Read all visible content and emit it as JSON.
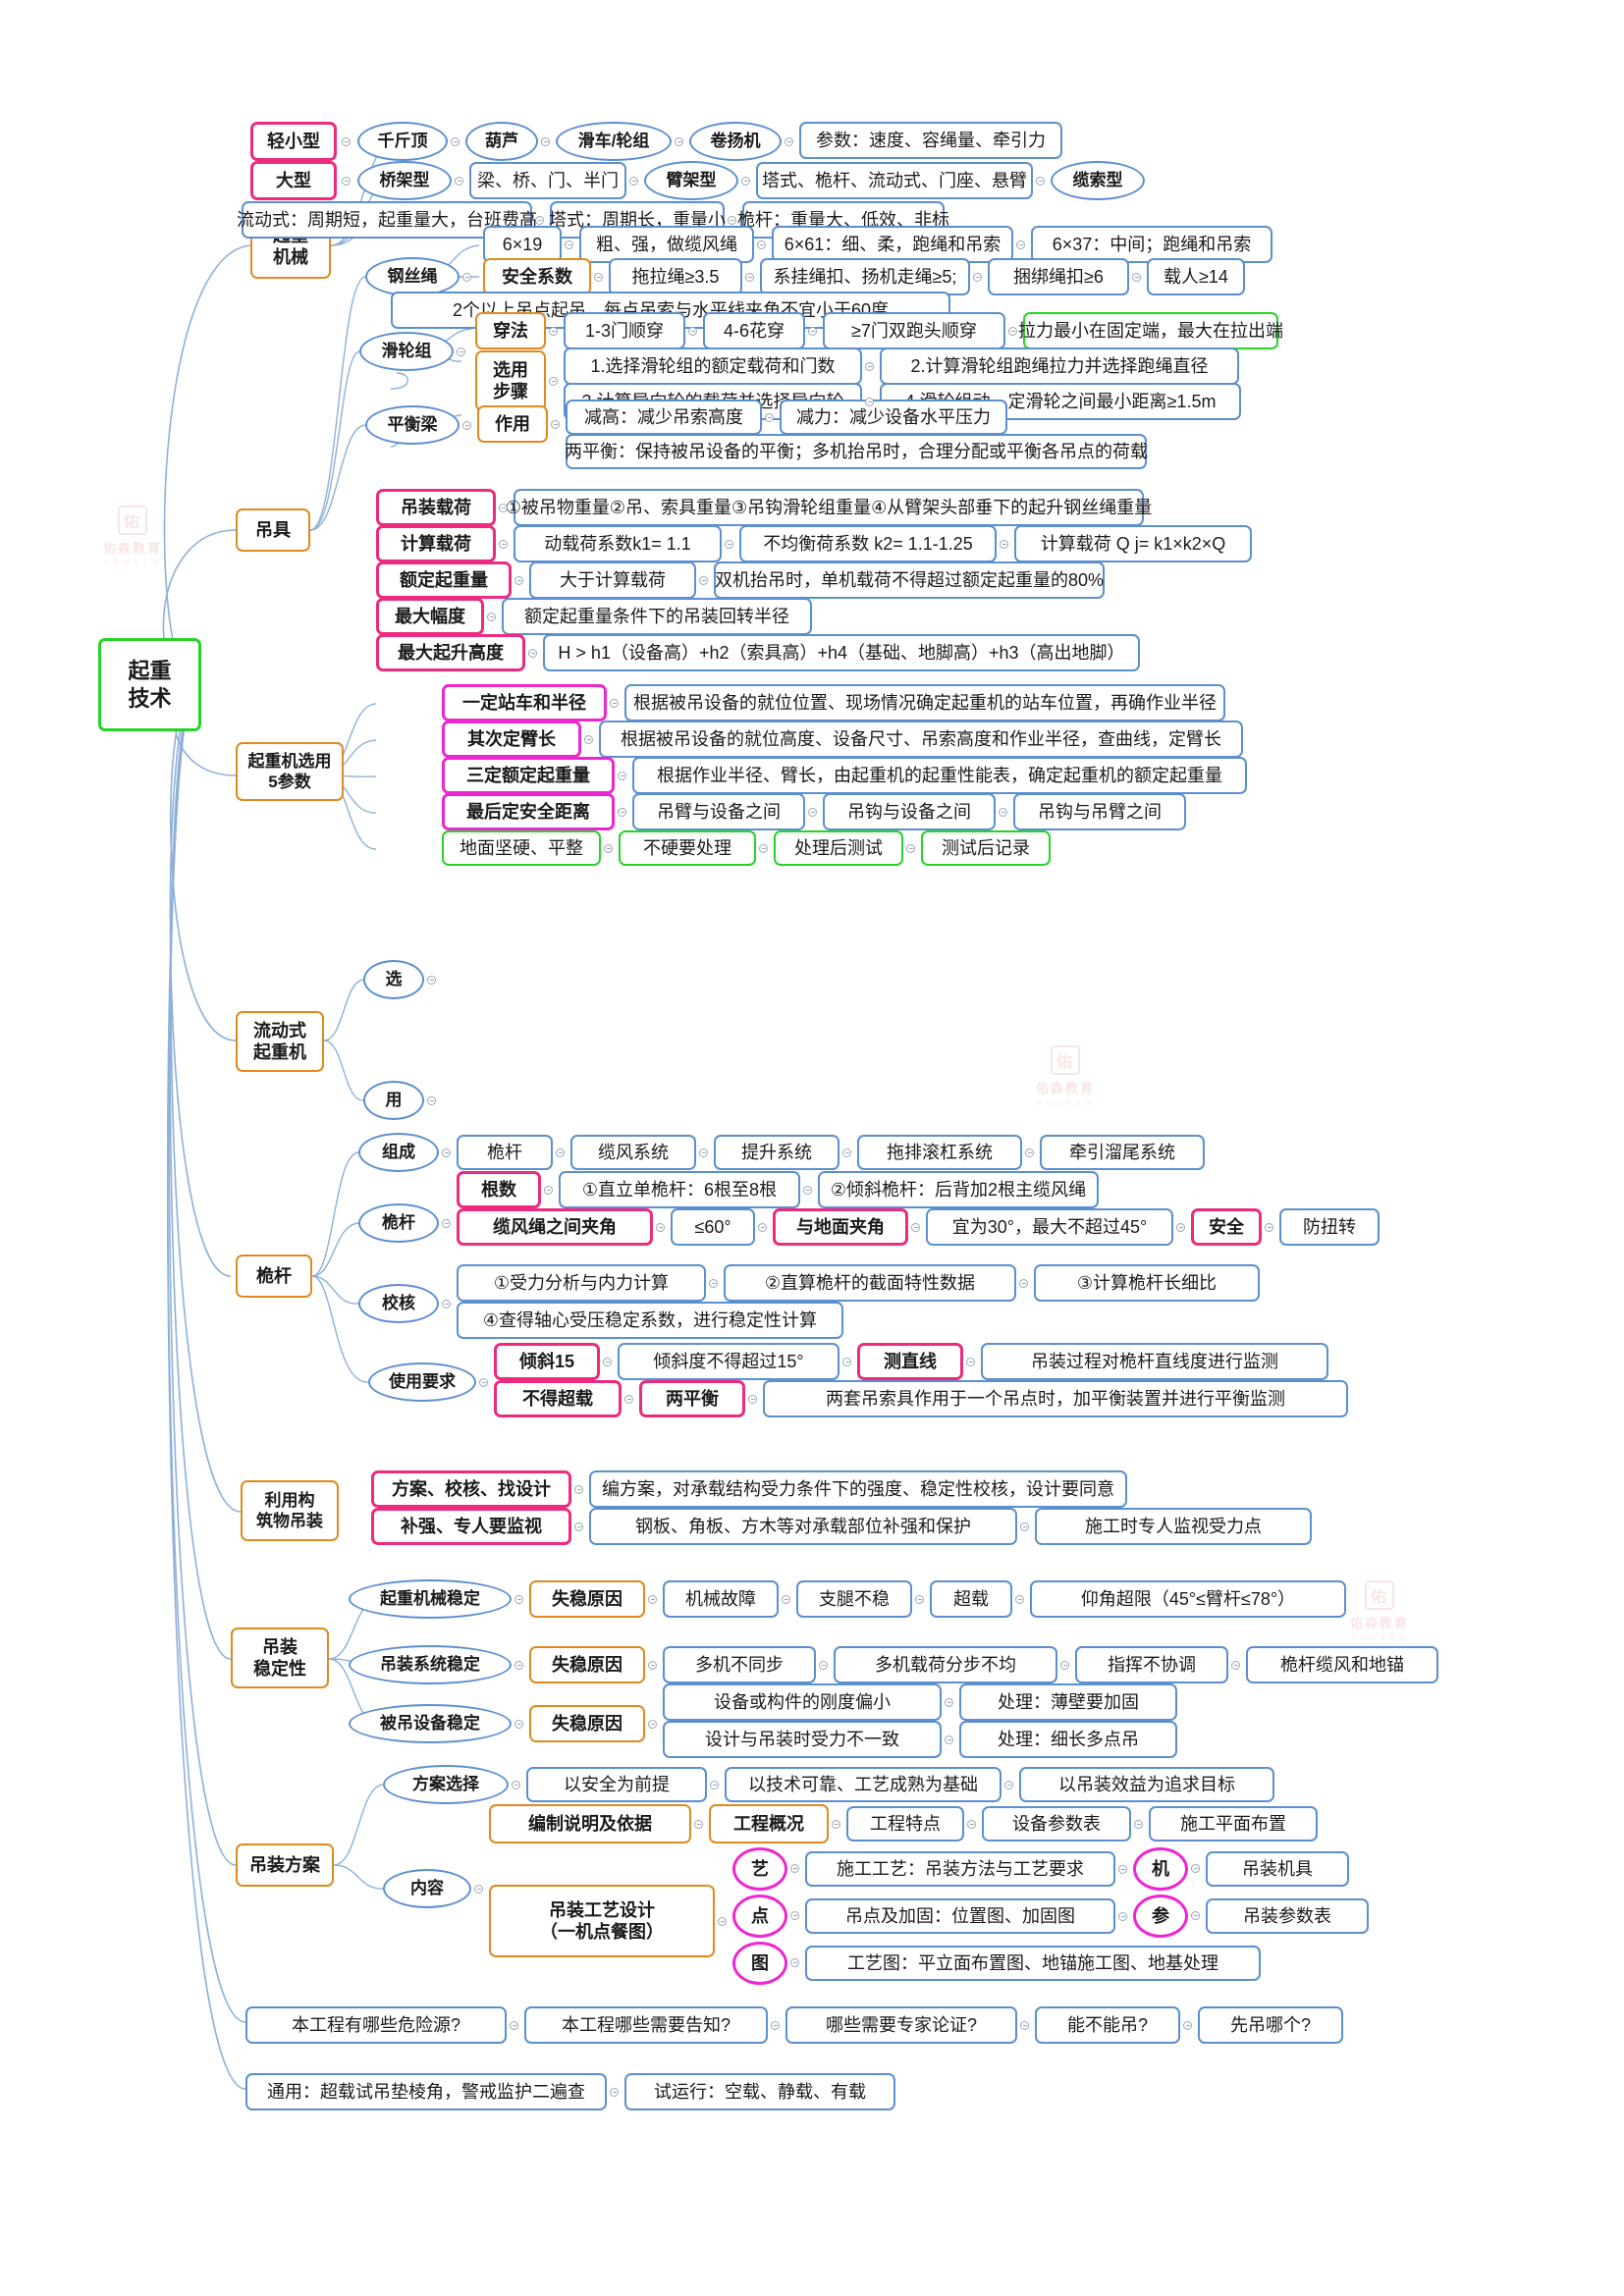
{
  "root": {
    "label": "起重\n技术"
  },
  "watermark": {
    "mark": "佑",
    "name": "佑森教育",
    "sub": "ＹＯＵＳＥＮ"
  },
  "branches": {
    "qizhong_jixie": {
      "label": "起重\n机械",
      "rows": [
        {
          "head": "轻小型",
          "items": [
            "千斤顶",
            "葫芦",
            "滑车/轮组",
            "卷扬机",
            "参数：速度、容绳量、牵引力"
          ]
        },
        {
          "head": "大型",
          "items": [
            "桥架型",
            "梁、桥、门、半门",
            "臂架型",
            "塔式、桅杆、流动式、门座、悬臂",
            "缆索型"
          ]
        },
        {
          "head": "",
          "items": [
            "流动式：周期短，起重量大，台班费高",
            "塔式：周期长，重量小",
            "桅杆：重量大、低效、非标"
          ]
        }
      ]
    },
    "diaoju": {
      "label": "吊具",
      "gangsisheng": {
        "label": "钢丝绳",
        "row1": [
          "6×19",
          "粗、强，做缆风绳",
          "6×61：细、柔，跑绳和吊索",
          "6×37：中间；跑绳和吊索"
        ],
        "anquan_xishu": "安全系数",
        "row2": [
          "拖拉绳≥3.5",
          "系挂绳扣、扬机走绳≥5;",
          "捆绑绳扣≥6",
          "载人≥14"
        ],
        "row3": "2个以上吊点起吊，每点吊索与水平线夹角不宜小于60度"
      },
      "hualunzu": {
        "label": "滑轮组",
        "chuanfa": "穿法",
        "chuanfa_items": [
          "1-3门顺穿",
          "4-6花穿",
          "≥7门双跑头顺穿",
          "拉力最小在固定端，最大在拉出端"
        ],
        "xuanyong": "选用\n步骤",
        "steps": [
          "1.选择滑轮组的额定载荷和门数",
          "2.计算滑轮组跑绳拉力并选择跑绳直径",
          "3.计算导向轮的载荷并选择导向轮",
          "4.滑轮组动、定滑轮之间最小距离≥1.5m"
        ]
      },
      "pinghengliang": {
        "label": "平衡梁",
        "zuoyong": "作用",
        "items": [
          "减高：减少吊索高度",
          "减力：减少设备水平压力"
        ],
        "line2": "两平衡：保持被吊设备的平衡；多机抬吊时，合理分配或平衡各吊点的荷载"
      }
    },
    "wucanshu": {
      "label": "起重机选用\n5参数",
      "rows": [
        {
          "head": "吊装载荷",
          "items": [
            "①被吊物重量②吊、索具重量③吊钩滑轮组重量④从臂架头部垂下的起升钢丝绳重量"
          ]
        },
        {
          "head": "计算载荷",
          "items": [
            "动载荷系数k1= 1.1",
            "不均衡荷系数 k2= 1.1-1.25",
            "计算载荷 Q j= k1×k2×Q"
          ]
        },
        {
          "head": "额定起重量",
          "items": [
            "大于计算载荷",
            "双机抬吊时，单机载荷不得超过额定起重量的80%"
          ]
        },
        {
          "head": "最大幅度",
          "items": [
            "额定起重量条件下的吊装回转半径"
          ]
        },
        {
          "head": "最大起升高度",
          "items": [
            "H > h1（设备高）+h2（索具高）+h4（基础、地脚高）+h3（高出地脚）"
          ]
        }
      ]
    },
    "liudongshi": {
      "label": "流动式\n起重机",
      "xuan": "选",
      "xuan_rows": [
        {
          "head": "一定站车和半径",
          "text": "根据被吊设备的就位位置、现场情况确定起重机的站车位置，再确作业半径"
        },
        {
          "head": "其次定臂长",
          "text": "根据被吊设备的就位高度、设备尺寸、吊索高度和作业半径，查曲线，定臂长"
        },
        {
          "head": "三定额定起重量",
          "text": "根据作业半径、臂长，由起重机的起重性能表，确定起重机的额定起重量"
        },
        {
          "head": "最后定安全距离",
          "items": [
            "吊臂与设备之间",
            "吊钩与设备之间",
            "吊钩与吊臂之间"
          ]
        }
      ],
      "yong": "用",
      "yong_items": [
        "地面坚硬、平整",
        "不硬要处理",
        "处理后测试",
        "测试后记录"
      ]
    },
    "weigan": {
      "label": "桅杆",
      "zucheng": {
        "label": "组成",
        "items": [
          "桅杆",
          "缆风系统",
          "提升系统",
          "拖排滚杠系统",
          "牵引溜尾系统"
        ]
      },
      "weigan2": {
        "label": "桅杆",
        "genshu": "根数",
        "genshu_items": [
          "①直立单桅杆：6根至8根",
          "②倾斜桅杆：后背加2根主缆风绳"
        ],
        "jiajiao": "缆风绳之间夹角",
        "jiajiao_items": [
          "≤60°"
        ],
        "didian": "与地面夹角",
        "didian_items": [
          "宜为30°，最大不超过45°"
        ],
        "anquan": "安全",
        "anquan_items": [
          "防扭转"
        ]
      },
      "jiaohe": {
        "label": "校核",
        "items": [
          "①受力分析与内力计算",
          "②直算桅杆的截面特性数据",
          "③计算桅杆长细比",
          "④查得轴心受压稳定系数，进行稳定性计算"
        ]
      },
      "shiyong": {
        "label": "使用要求",
        "qingxie": "倾斜15",
        "qingxie_text": "倾斜度不得超过15°",
        "cezhixian": "测直线",
        "cezhixian_text": "吊装过程对桅杆直线度进行监测",
        "budechaozai": "不得超载",
        "liangpingheng": "两平衡",
        "liangpingheng_text": "两套吊索具作用于一个吊点时，加平衡装置并进行平衡监测"
      }
    },
    "gouzhuwu": {
      "label": "利用构\n筑物吊装",
      "rows": [
        {
          "head": "方案、校核、找设计",
          "items": [
            "编方案，对承载结构受力条件下的强度、稳定性校核，设计要同意"
          ]
        },
        {
          "head": "补强、专人要监视",
          "items": [
            "钢板、角板、方木等对承载部位补强和保护",
            "施工时专人监视受力点"
          ]
        }
      ]
    },
    "wendingxing": {
      "label": "吊装\n稳定性",
      "rows": [
        {
          "head": "起重机械稳定",
          "tag": "失稳原因",
          "items": [
            "机械故障",
            "支腿不稳",
            "超载",
            "仰角超限（45°≤臂杆≤78°）"
          ]
        },
        {
          "head": "吊装系统稳定",
          "tag": "失稳原因",
          "items": [
            "多机不同步",
            "多机载荷分步不均",
            "指挥不协调",
            "桅杆缆风和地锚"
          ]
        },
        {
          "head": "被吊设备稳定",
          "tag": "失稳原因",
          "items": [],
          "pairs": [
            [
              "设备或构件的刚度偏小",
              "处理：薄壁要加固"
            ],
            [
              "设计与吊装时受力不一致",
              "处理：细长多点吊"
            ]
          ]
        }
      ]
    },
    "fangan": {
      "label": "吊装方案",
      "xuanze": {
        "label": "方案选择",
        "items": [
          "以安全为前提",
          "以技术可靠、工艺成熟为基础",
          "以吊装效益为追求目标"
        ]
      },
      "neirong": {
        "label": "内容",
        "bianzhi": "编制说明及依据",
        "gaikuang": "工程概况",
        "gaikuang_items": [
          "工程特点",
          "设备参数表",
          "施工平面布置"
        ],
        "gongyi": "吊装工艺设计\n（一机点餐图）",
        "badges": [
          {
            "badge": "艺",
            "text": "施工工艺：吊装方法与工艺要求",
            "badge2": "机",
            "text2": "吊装机具"
          },
          {
            "badge": "点",
            "text": "吊点及加固：位置图、加固图",
            "badge2": "参",
            "text2": "吊装参数表"
          },
          {
            "badge": "图",
            "text": "工艺图：平立面布置图、地锚施工图、地基处理",
            "badge2": "",
            "text2": ""
          }
        ]
      }
    },
    "questions": [
      "本工程有哪些危险源?",
      "本工程哪些需要告知?",
      "哪些需要专家论证?",
      "能不能吊?",
      "先吊哪个?"
    ],
    "general": [
      "通用：超载试吊垫棱角，警戒监护二遍查",
      "试运行：空载、静载、有载"
    ]
  },
  "colors": {
    "blue": "#5b8fd0",
    "orange": "#e08a1e",
    "pink": "#ec2a7e",
    "green": "#25d426",
    "magenta": "#ec27cf",
    "text": "#1a1a1a"
  }
}
